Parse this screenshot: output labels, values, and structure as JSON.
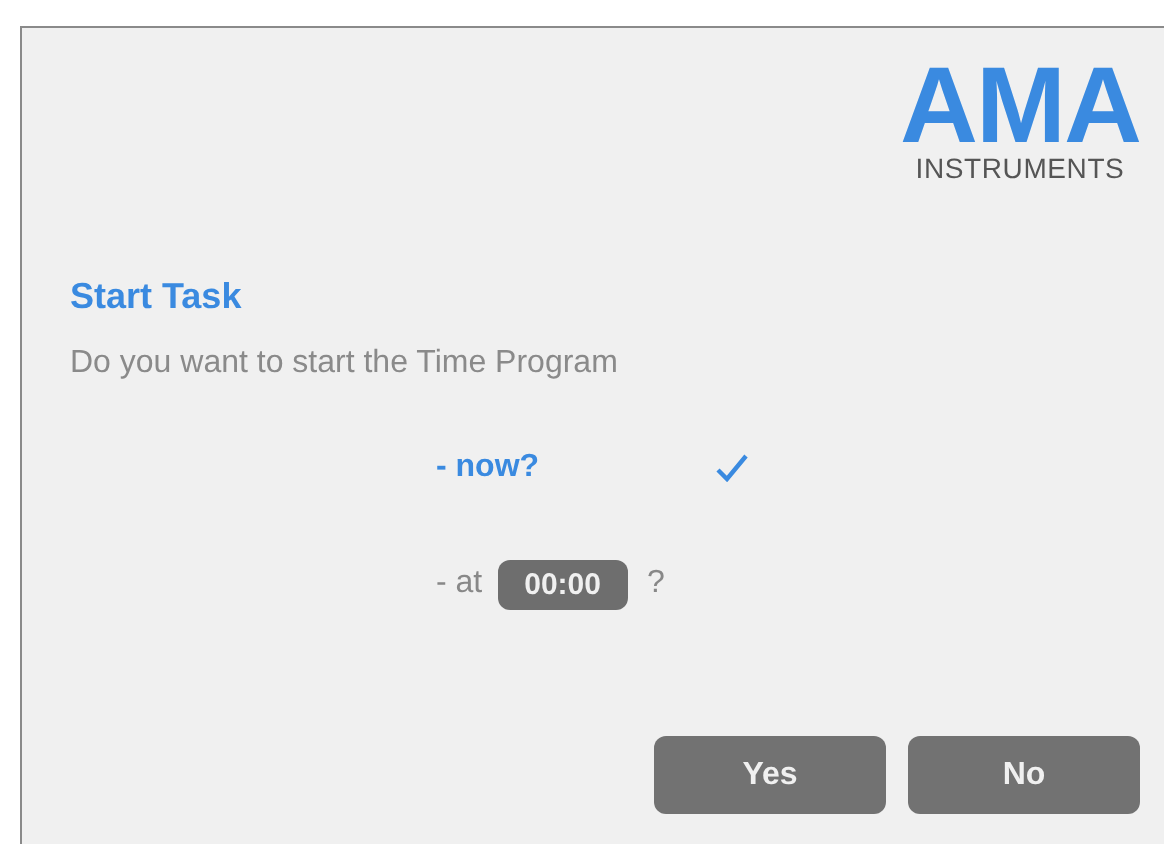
{
  "logo": {
    "name": "AMA",
    "subtitle": "INSTRUMENTS"
  },
  "dialog": {
    "title": "Start Task",
    "message": "Do you want to start the Time Program"
  },
  "options": [
    {
      "kind": "now",
      "label": "- now?",
      "selected": true
    },
    {
      "kind": "time",
      "label": "- at",
      "value": "00:00",
      "suffix": "?",
      "selected": false
    }
  ],
  "buttons": [
    "Yes",
    "No"
  ]
}
